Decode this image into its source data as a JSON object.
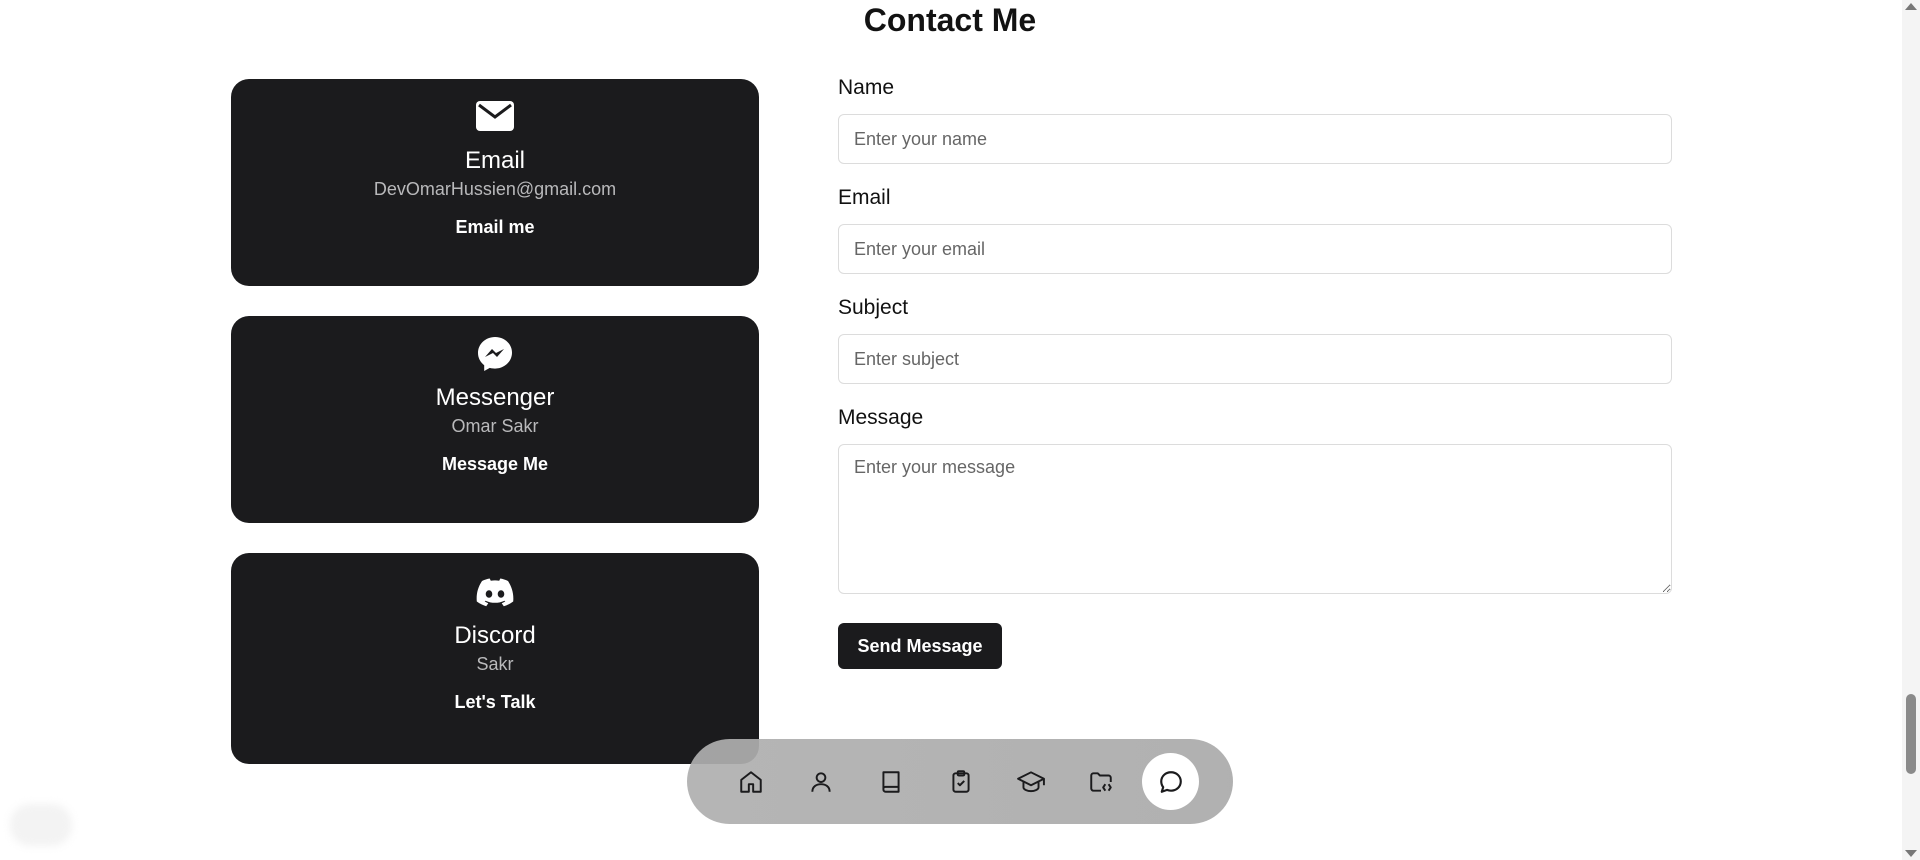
{
  "section_title": "Contact Me",
  "cards": [
    {
      "icon": "envelope-icon",
      "title": "Email",
      "value": "DevOmarHussien@gmail.com",
      "link": "Email me"
    },
    {
      "icon": "messenger-icon",
      "title": "Messenger",
      "value": "Omar Sakr",
      "link": "Message Me"
    },
    {
      "icon": "discord-icon",
      "title": "Discord",
      "value": "Sakr",
      "link": "Let's Talk"
    }
  ],
  "form": {
    "name_label": "Name",
    "name_placeholder": "Enter your name",
    "email_label": "Email",
    "email_placeholder": "Enter your email",
    "subject_label": "Subject",
    "subject_placeholder": "Enter subject",
    "message_label": "Message",
    "message_placeholder": "Enter your message",
    "submit_label": "Send Message"
  },
  "dock": {
    "items": [
      "home-icon",
      "user-icon",
      "book-icon",
      "clipboard-check-icon",
      "graduation-cap-icon",
      "folder-code-icon",
      "chat-bubble-icon"
    ],
    "active": "chat-bubble-icon"
  },
  "colors": {
    "card_bg": "#1b1b1d",
    "accent": "#1b1b1d",
    "dock_bg": "#afafaf"
  }
}
